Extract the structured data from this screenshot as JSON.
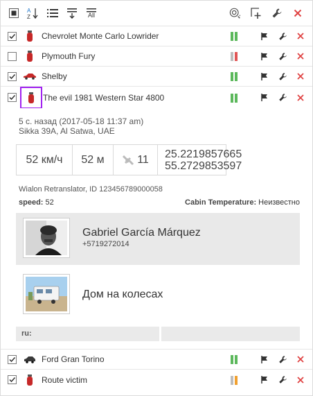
{
  "toolbar": {
    "left_icons": [
      "select-all-icon",
      "sort-az-icon",
      "list-icon",
      "filter-icon",
      "all-icon"
    ],
    "all_label": "All",
    "right_icons": [
      "search-location-icon",
      "add-icon",
      "wrench-icon",
      "close-icon"
    ]
  },
  "units": [
    {
      "name": "Chevrolet Monte Carlo Lowrider",
      "checked": true,
      "icon": "fire-extinguisher-icon",
      "signal": [
        "#5cb85c",
        "#5cb85c"
      ]
    },
    {
      "name": "Plymouth Fury",
      "checked": false,
      "icon": "fire-extinguisher-icon",
      "signal": [
        "#bdbdbd",
        "#e05555"
      ]
    },
    {
      "name": "Shelby",
      "checked": true,
      "icon": "red-car-icon",
      "signal": [
        "#5cb85c",
        "#5cb85c"
      ]
    },
    {
      "name": "The evil 1981 Western Star 4800",
      "checked": true,
      "icon": "fire-extinguisher-icon",
      "signal": [
        "#5cb85c",
        "#5cb85c"
      ]
    },
    {
      "name": "Ford Gran Torino",
      "checked": true,
      "icon": "car-icon",
      "signal": [
        "#5cb85c",
        "#5cb85c"
      ]
    },
    {
      "name": "Route victim",
      "checked": true,
      "icon": "fire-extinguisher-icon",
      "signal": [
        "#bdbdbd",
        "#f0a030"
      ]
    }
  ],
  "details": {
    "time_line": "5 с. назад (2017-05-18 11:37 am)",
    "address": "Sikka 39A, Al Satwa, UAE",
    "speed": "52 км/ч",
    "altitude": "52 м",
    "satellites": "11",
    "lat": "25.2219857665",
    "lon": "55.2729853597",
    "retranslator": "Wialon Retranslator, ID 123456789000058",
    "speed_label": "speed:",
    "speed_value": "52",
    "cabin_label": "Cabin Temperature:",
    "cabin_value": "Неизвестно",
    "driver_name": "Gabriel García Márquez",
    "driver_phone": "+5719272014",
    "trailer_name": "Дом на колесах",
    "ru_label": "ru:"
  },
  "colors": {
    "red_x": "#e04343",
    "dark_icon": "#333333",
    "selection_border": "#a020f0"
  }
}
